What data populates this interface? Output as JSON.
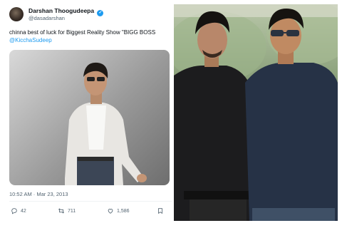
{
  "tweet": {
    "author_name": "Darshan Thoogudeepa",
    "handle": "@dasadarshan",
    "text": "chinna best of luck for Biggest Reality Show \"BIGG BOSS",
    "mention": "@KicchaSudeep",
    "timestamp": "10:52 AM · Mar 23, 2013",
    "actions": {
      "replies": "42",
      "retweets": "711",
      "likes": "1,586"
    }
  },
  "colors": {
    "link": "#1d9bf0",
    "text_primary": "#0f1419",
    "text_secondary": "#536471"
  },
  "icons": [
    "verified-badge-icon",
    "reply-icon",
    "retweet-icon",
    "like-icon",
    "bookmark-icon"
  ]
}
